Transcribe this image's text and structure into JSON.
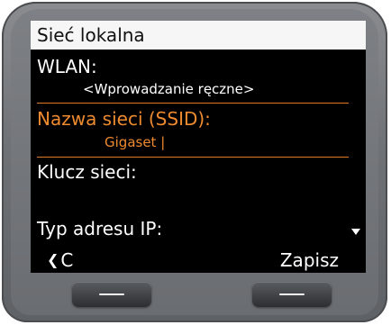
{
  "screen": {
    "title": "Sieć lokalna",
    "fields": [
      {
        "label": "WLAN:",
        "value": "<Wprowadzanie ręczne>",
        "selected": false
      },
      {
        "label": "Nazwa sieci (SSID):",
        "value": "Gigaset |",
        "selected": true
      },
      {
        "label": "Klucz sieci:",
        "value": "",
        "selected": false
      },
      {
        "label": "Typ adresu IP:",
        "value": "",
        "selected": false
      }
    ],
    "highlight_color": "#ee8a2f"
  },
  "softkeys": {
    "left_icon": "back-arrow-icon",
    "left_label": "C",
    "right_label": "Zapisz"
  },
  "hardware_keys": [
    "left-softkey",
    "right-softkey"
  ]
}
